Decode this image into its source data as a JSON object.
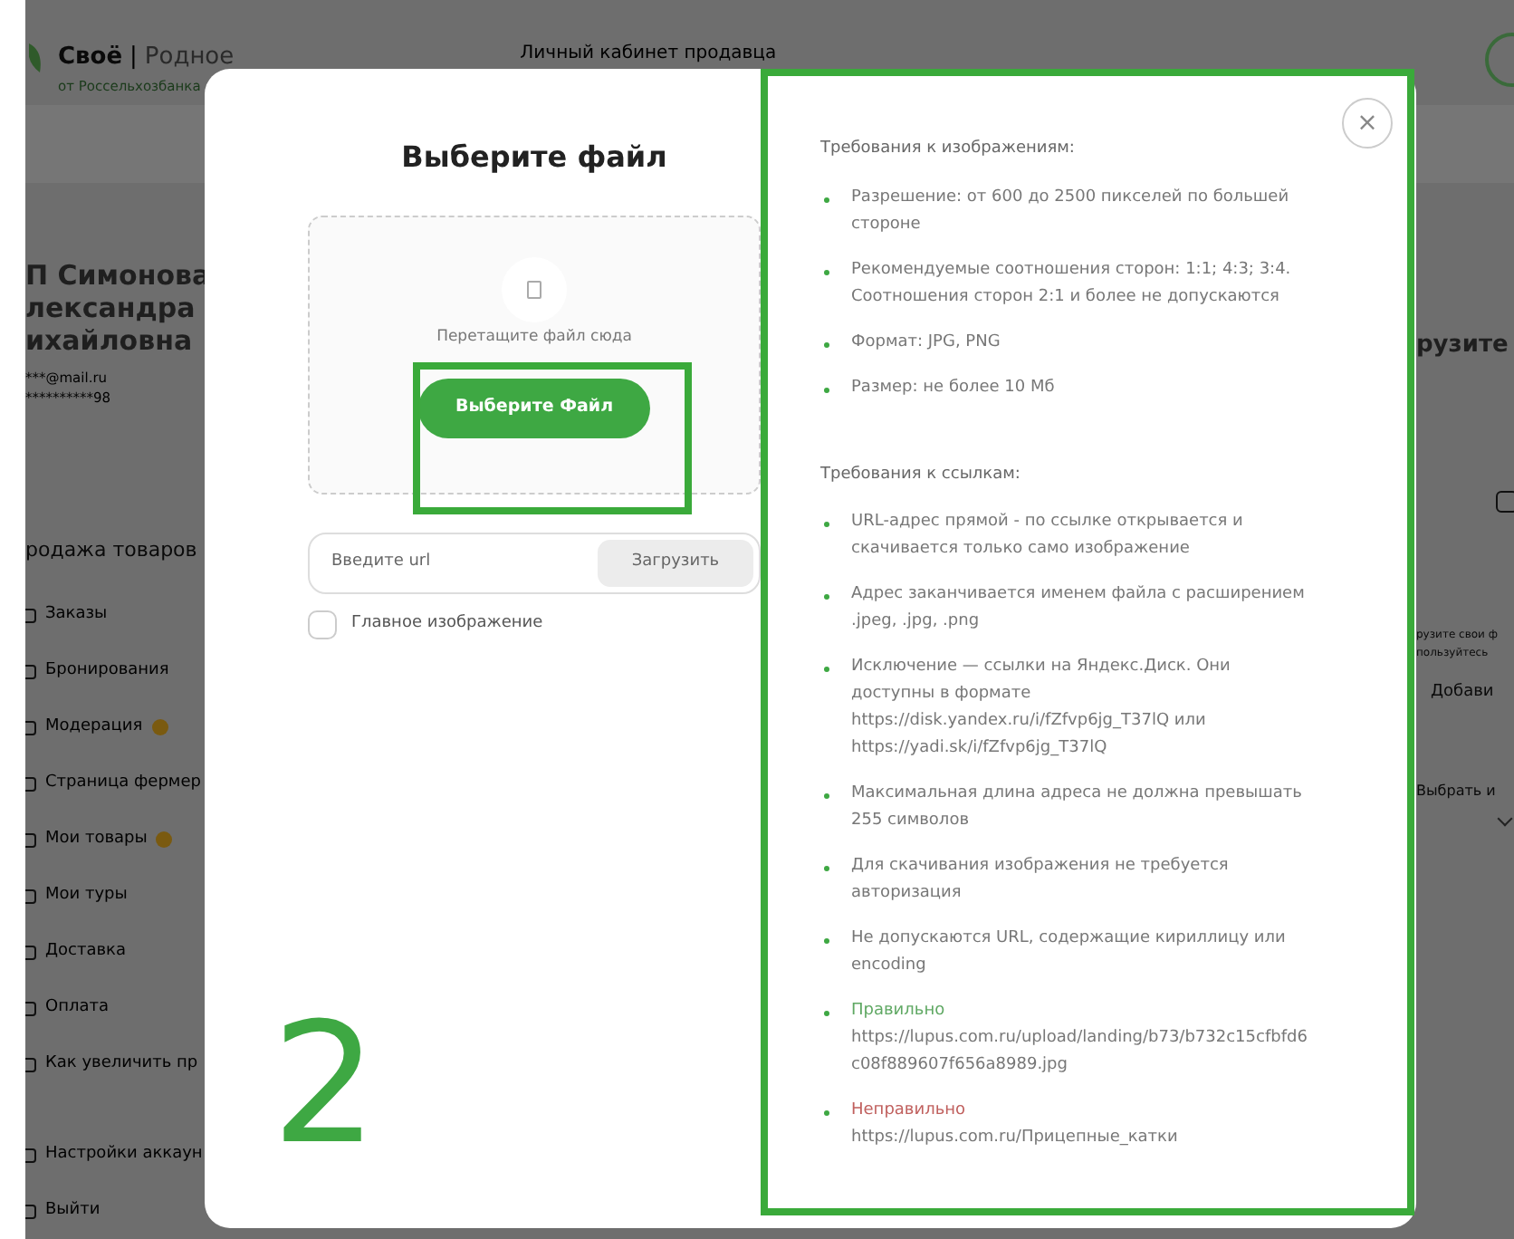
{
  "background": {
    "logo": {
      "brand": "Своё",
      "separator": "|",
      "name": "Родное",
      "subtitle": "от Россельхозбанка"
    },
    "header_title": "Личный кабинет продавца",
    "profile": {
      "name_lines": [
        "П Симонова",
        "лександра",
        "ихайловна"
      ],
      "email": "***@mail.ru",
      "phone": "**********98"
    },
    "section": "родажа товаров",
    "menu": [
      {
        "label": "Заказы",
        "badge": false
      },
      {
        "label": "Бронирования",
        "badge": false
      },
      {
        "label": "Модерация",
        "badge": true
      },
      {
        "label": "Страница фермер",
        "badge": false
      },
      {
        "label": "Мои товары",
        "badge": true
      },
      {
        "label": "Мои туры",
        "badge": false
      },
      {
        "label": "Доставка",
        "badge": false
      },
      {
        "label": "Оплата",
        "badge": false
      },
      {
        "label": "Как увеличить пр",
        "badge": false
      }
    ],
    "menu_bottom": [
      {
        "label": "Настройки аккаун",
        "badge": false
      },
      {
        "label": "Выйти",
        "badge": false
      }
    ],
    "main": {
      "heading": "рузите",
      "hint_lines": [
        "рузите свои ф",
        "пользуйтесь"
      ],
      "add_button": "Добави",
      "select_label": "Выбрать и"
    }
  },
  "modal": {
    "title": "Выберите файл",
    "close": "×",
    "dropzone": {
      "hint": "Перетащите файл сюда",
      "button": "Выберите Файл"
    },
    "url": {
      "placeholder": "Введите url",
      "button": "Загрузить"
    },
    "main_image": {
      "label": "Главное изображение",
      "checked": false
    },
    "requirements": [
      {
        "heading": "Требования к изображениям:",
        "items": [
          {
            "kind": "plain",
            "text": "Разрешение: от 600 до 2500 пикселей по большей стороне"
          },
          {
            "kind": "plain",
            "text": "Рекомендуемые соотношения сторон: 1:1; 4:3; 3:4. Соотношения сторон 2:1 и более не допускаются"
          },
          {
            "kind": "plain",
            "text": "Формат: JPG, PNG"
          },
          {
            "kind": "plain",
            "text": "Размер: не более 10 Мб"
          }
        ]
      },
      {
        "heading": "Требования к ссылкам:",
        "items": [
          {
            "kind": "plain",
            "text": "URL-адрес прямой - по ссылке открывается и скачивается только само изображение"
          },
          {
            "kind": "plain",
            "text": "Адрес заканчивается именем файла с расширением .jpeg, .jpg, .png"
          },
          {
            "kind": "plain",
            "text": "Исключение — ссылки на Яндекс.Диск. Они доступны в формате https://disk.yandex.ru/i/fZfvp6jg_T37lQ или https://yadi.sk/i/fZfvp6jg_T37lQ"
          },
          {
            "kind": "plain",
            "text": "Максимальная длина адреса не должна превышать 255 символов"
          },
          {
            "kind": "plain",
            "text": "Для скачивания изображения не требуется авторизация"
          },
          {
            "kind": "plain",
            "text": "Не допускаются URL, содержащие кириллицу или encoding"
          },
          {
            "kind": "correct",
            "label": "Правильно",
            "text": "https://lupus.com.ru/upload/landing/b73/b732c15cfbfd6c08f889607f656a8989.jpg"
          },
          {
            "kind": "incorrect",
            "label": "Неправильно",
            "text": "https://lupus.com.ru/Прицепные_катки"
          }
        ]
      }
    ]
  },
  "annotation": {
    "number": "2"
  }
}
